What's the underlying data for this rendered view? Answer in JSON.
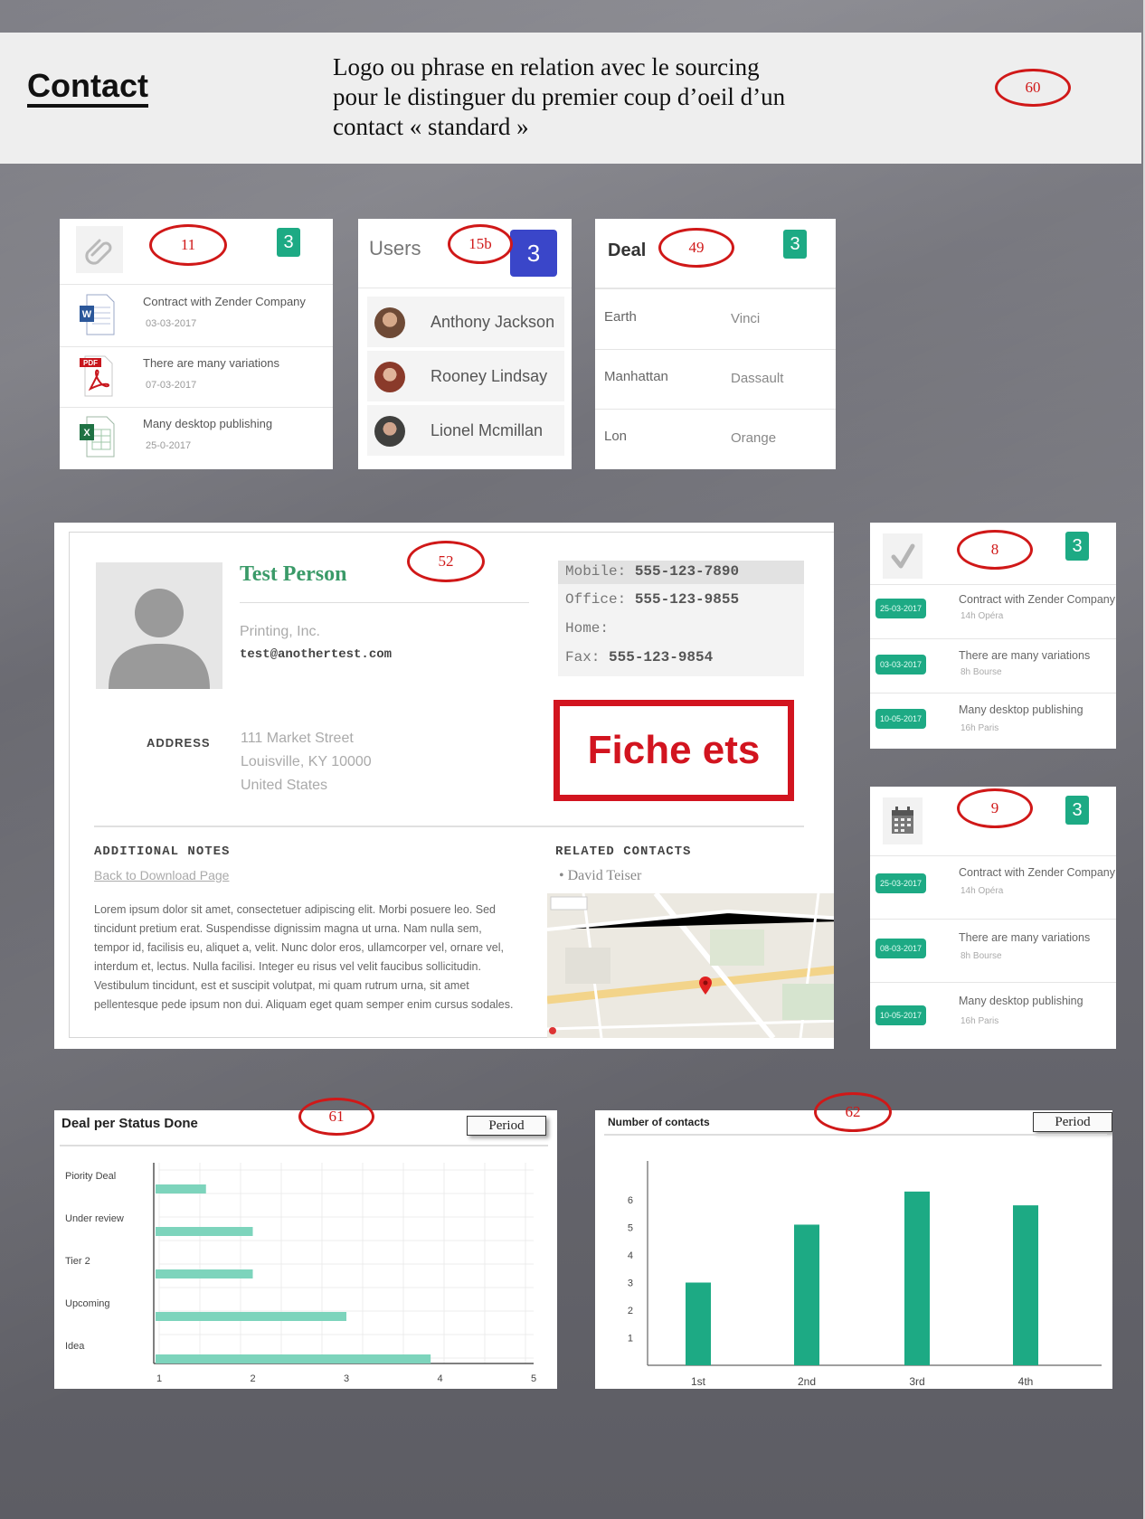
{
  "header": {
    "title": "Contact",
    "description": "Logo ou phrase en relation avec le sourcing pour le distinguer du premier coup d’oeil d’un contact « standard »"
  },
  "annotations": {
    "a60": "60",
    "a11": "11",
    "a15b": "15b",
    "a49": "49",
    "a52": "52",
    "a8": "8",
    "a9": "9",
    "a61": "61",
    "a62": "62"
  },
  "files_card": {
    "icon": "paperclip-icon",
    "badge": "3",
    "items": [
      {
        "name": "Contract with Zender Company",
        "date": "03-03-2017",
        "icon": "word-doc-icon"
      },
      {
        "name": "There are many variations",
        "date": "07-03-2017",
        "icon": "pdf-doc-icon"
      },
      {
        "name": "Many desktop publishing",
        "date": "25-0-2017",
        "icon": "excel-doc-icon"
      }
    ]
  },
  "users_card": {
    "title": "Users",
    "badge": "3",
    "users": [
      {
        "name": "Anthony Jackson"
      },
      {
        "name": "Rooney Lindsay"
      },
      {
        "name": "Lionel Mcmillan"
      }
    ]
  },
  "deal_card": {
    "title": "Deal",
    "badge": "3",
    "rows": [
      {
        "c1": "Earth",
        "c2": "Vinci"
      },
      {
        "c1": "Manhattan",
        "c2": "Dassault"
      },
      {
        "c1": "Lon",
        "c2": "Orange"
      }
    ]
  },
  "contact_sheet": {
    "name": "Test Person",
    "company": "Printing, Inc.",
    "email": "test@anothertest.com",
    "phones": {
      "mobile_label": "Mobile:",
      "mobile": "555-123-7890",
      "office_label": "Office:",
      "office": "555-123-9855",
      "home_label": "Home:",
      "fax_label": "Fax:",
      "fax": "555-123-9854"
    },
    "address_label": "ADDRESS",
    "address": [
      "111 Market Street",
      "Louisville, KY 10000",
      "United States"
    ],
    "fiche_label": "Fiche ets",
    "notes_heading": "ADDITIONAL NOTES",
    "notes_link": "Back to Download Page",
    "notes_text": "Lorem ipsum dolor sit amet, consectetuer adipiscing elit. Morbi posuere leo. Sed tincidunt pretium erat. Suspendisse dignissim magna ut urna. Nam nulla sem, tempor id, facilisis eu, aliquet a, velit. Nunc dolor eros, ullamcorper vel, ornare vel, interdum et, lectus. Nulla facilisi. Integer eu risus vel velit faucibus sollicitudin. Vestibulum tincidunt, est et suscipit volutpat, mi quam rutrum urna, sit amet pellentesque pede ipsum non dui. Aliquam eget quam semper enim cursus sodales.",
    "related_heading": "RELATED CONTACTS",
    "related": [
      "David Teiser"
    ]
  },
  "task_card_8": {
    "icon": "checkmark-icon",
    "badge": "3",
    "tasks": [
      {
        "date": "25-03-2017",
        "name": "Contract with Zender Company",
        "sub": "14h Opéra"
      },
      {
        "date": "03-03-2017",
        "name": "There are many variations",
        "sub": "8h Bourse"
      },
      {
        "date": "10-05-2017",
        "name": "Many desktop publishing",
        "sub": "16h Paris"
      }
    ]
  },
  "task_card_9": {
    "icon": "calendar-icon",
    "badge": "3",
    "tasks": [
      {
        "date": "25-03-2017",
        "name": "Contract with Zender Company",
        "sub": "14h Opéra"
      },
      {
        "date": "08-03-2017",
        "name": "There are many variations",
        "sub": "8h Bourse"
      },
      {
        "date": "10-05-2017",
        "name": "Many desktop publishing",
        "sub": "16h Paris"
      }
    ]
  },
  "charts_ui": {
    "period_label": "Period"
  },
  "chart_data": [
    {
      "type": "bar",
      "orientation": "horizontal",
      "title": "Deal per Status Done",
      "categories": [
        "Piority Deal",
        "Under review",
        "Tier 2",
        "Upcoming",
        "Idea"
      ],
      "values": [
        1.5,
        2.0,
        2.0,
        3.0,
        3.9
      ],
      "xlim": [
        1,
        5
      ],
      "xticks": [
        "1",
        "2",
        "3",
        "4",
        "5"
      ],
      "grid": true,
      "color": "#7dd4bc"
    },
    {
      "type": "bar",
      "title": "Number of contacts",
      "categories": [
        "1st",
        "2nd",
        "3rd",
        "4th"
      ],
      "values": [
        3.0,
        5.1,
        6.3,
        5.8
      ],
      "ylim": [
        0,
        7
      ],
      "yticks": [
        "1",
        "2",
        "3",
        "4",
        "5",
        "6"
      ],
      "grid": false,
      "color": "#1daa84"
    }
  ]
}
